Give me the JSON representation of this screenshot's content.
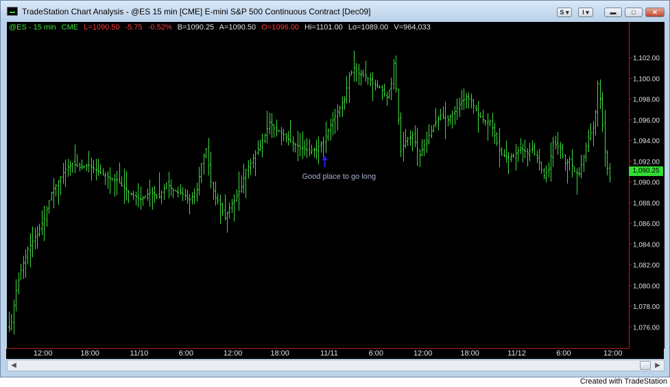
{
  "window": {
    "title": "TradeStation Chart Analysis - @ES 15 min [CME] E-mini S&P 500 Continuous Contract [Dec09]",
    "buttons": {
      "s_menu": "S ▾",
      "i_menu": "I ▾"
    }
  },
  "status_line": {
    "symbol": "@ES - 15 min",
    "exchange": "CME",
    "last": "L=1090.50",
    "net_change": "-5.75",
    "pct_change": "-0.52%",
    "bid": "B=1090.25",
    "ask": "A=1090.50",
    "open": "O=1096.00",
    "high": "Hi=1101.00",
    "low": "Lo=1089.00",
    "volume": "V=964,033"
  },
  "colors": {
    "bars": "#3ddf3d",
    "axis": "#b02020",
    "negative": "#ff3a3a",
    "text": "#e0e0e0",
    "annotation_arrow": "#2222ee"
  },
  "annotation": {
    "text": "Good place to go long",
    "price": 1092.9
  },
  "current_price_label": "1,090.25",
  "footer": "Created with TradeStation",
  "chart_data": {
    "type": "ohlc",
    "y_range": [
      1074.5,
      1104.0
    ],
    "y_ticks": [
      "1,102.00",
      "1,100.00",
      "1,098.00",
      "1,096.00",
      "1,094.00",
      "1,092.00",
      "1,090.00",
      "1,088.00",
      "1,086.00",
      "1,084.00",
      "1,082.00",
      "1,080.00",
      "1,078.00",
      "1,076.00"
    ],
    "y_tick_values": [
      1102,
      1100,
      1098,
      1096,
      1094,
      1092,
      1090,
      1088,
      1086,
      1084,
      1082,
      1080,
      1078,
      1076
    ],
    "x_ticks": [
      "12:00",
      "18:00",
      "11/10",
      "6:00",
      "12:00",
      "18:00",
      "11/11",
      "6:00",
      "12:00",
      "18:00",
      "11/12",
      "6:00",
      "12:00"
    ],
    "x_tick_bars": [
      4,
      24,
      45,
      65,
      85,
      105,
      126,
      146,
      166,
      186,
      206,
      226,
      247
    ],
    "close_path": [
      [
        0,
        1076.0
      ],
      [
        1,
        1076.5
      ],
      [
        3,
        1079.5
      ],
      [
        5,
        1081.5
      ],
      [
        8,
        1083.5
      ],
      [
        12,
        1085.0
      ],
      [
        15,
        1086.5
      ],
      [
        18,
        1089.0
      ],
      [
        21,
        1090.0
      ],
      [
        24,
        1091.3
      ],
      [
        27,
        1091.8
      ],
      [
        30,
        1091.4
      ],
      [
        34,
        1091.6
      ],
      [
        38,
        1091.0
      ],
      [
        42,
        1090.5
      ],
      [
        46,
        1090.2
      ],
      [
        49,
        1089.4
      ],
      [
        52,
        1088.8
      ],
      [
        56,
        1088.3
      ],
      [
        60,
        1089.0
      ],
      [
        64,
        1088.5
      ],
      [
        67,
        1089.9
      ],
      [
        70,
        1089.2
      ],
      [
        74,
        1088.8
      ],
      [
        77,
        1088.3
      ],
      [
        80,
        1089.2
      ],
      [
        82,
        1091.8
      ],
      [
        84,
        1093.2
      ],
      [
        86,
        1090.0
      ],
      [
        88,
        1088.5
      ],
      [
        90,
        1087.8
      ],
      [
        92,
        1086.5
      ],
      [
        94,
        1087.5
      ],
      [
        96,
        1088.2
      ],
      [
        99,
        1089.5
      ],
      [
        101,
        1091.2
      ],
      [
        103,
        1091.8
      ],
      [
        105,
        1092.8
      ],
      [
        107,
        1093.5
      ],
      [
        109,
        1094.5
      ],
      [
        111,
        1095.8
      ],
      [
        113,
        1095.2
      ],
      [
        116,
        1094.8
      ],
      [
        118,
        1094.3
      ],
      [
        121,
        1093.8
      ],
      [
        124,
        1093.3
      ],
      [
        128,
        1093.0
      ],
      [
        131,
        1093.2
      ],
      [
        134,
        1093.9
      ],
      [
        137,
        1095.5
      ],
      [
        140,
        1096.8
      ],
      [
        143,
        1098.0
      ],
      [
        145,
        1100.2
      ],
      [
        147,
        1101.0
      ],
      [
        149,
        1100.5
      ],
      [
        152,
        1100.2
      ],
      [
        155,
        1099.6
      ],
      [
        158,
        1099.1
      ],
      [
        161,
        1098.2
      ],
      [
        163,
        1099.5
      ],
      [
        164,
        1101.5
      ],
      [
        165,
        1099.0
      ],
      [
        167,
        1093.0
      ],
      [
        169,
        1094.0
      ],
      [
        172,
        1094.5
      ],
      [
        175,
        1092.6
      ],
      [
        178,
        1094.0
      ],
      [
        181,
        1095.5
      ],
      [
        184,
        1096.4
      ],
      [
        187,
        1096.0
      ],
      [
        190,
        1096.8
      ],
      [
        193,
        1097.8
      ],
      [
        195,
        1098.2
      ],
      [
        197,
        1097.8
      ],
      [
        200,
        1096.5
      ],
      [
        203,
        1095.8
      ],
      [
        205,
        1095.9
      ],
      [
        207,
        1094.5
      ],
      [
        209,
        1093.0
      ],
      [
        212,
        1092.3
      ],
      [
        215,
        1092.5
      ],
      [
        218,
        1093.3
      ],
      [
        221,
        1092.8
      ],
      [
        223,
        1093.2
      ],
      [
        226,
        1091.8
      ],
      [
        228,
        1090.6
      ],
      [
        230,
        1091.2
      ],
      [
        232,
        1093.8
      ],
      [
        235,
        1093.2
      ],
      [
        237,
        1091.8
      ],
      [
        239,
        1092.2
      ],
      [
        241,
        1091.0
      ],
      [
        243,
        1090.8
      ],
      [
        245,
        1092.5
      ],
      [
        247,
        1094.3
      ],
      [
        249,
        1095.2
      ],
      [
        250,
        1096.8
      ],
      [
        251,
        1099.5
      ],
      [
        252,
        1098.0
      ],
      [
        253,
        1095.5
      ],
      [
        254,
        1093.0
      ],
      [
        255,
        1091.3
      ],
      [
        256,
        1090.4
      ]
    ]
  }
}
